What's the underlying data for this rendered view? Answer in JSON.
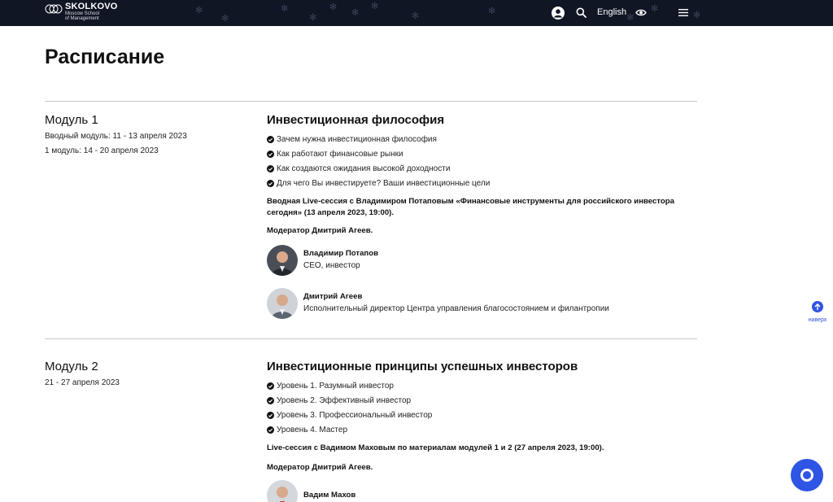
{
  "header": {
    "logo_name": "SKOLKOVO",
    "logo_sub1": "Moscow School",
    "logo_sub2": "of Management",
    "language": "English"
  },
  "page_title": "Расписание",
  "modules": [
    {
      "name": "Модуль 1",
      "dates": [
        "Вводный модуль: 11 - 13 апреля 2023",
        "1 модуль: 14 - 20 апреля 2023"
      ],
      "title": "Инвестиционная философия",
      "bullets": [
        "Зачем нужна инвестиционная философия",
        "Как работают финансовые рынки",
        "Как создаются ожидания высокой доходности",
        "Для чего Вы инвестируете? Ваши инвестиционные цели"
      ],
      "session": "Вводная Live-сессия с Владимиром Потаповым «Финансовые инструменты для российского инвестора сегодня» (13 апреля 2023, 19:00).",
      "moderator": "Модератор Дмитрий Агеев.",
      "speakers": [
        {
          "name": "Владимир Потапов",
          "role": "CEO, инвестор"
        },
        {
          "name": "Дмитрий Агеев",
          "role": "Исполнительный директор Центра управления благосостоянием и филантропии"
        }
      ]
    },
    {
      "name": "Модуль 2",
      "dates": [
        "21 - 27 апреля 2023"
      ],
      "title": "Инвестиционные принципы успешных инвесторов",
      "bullets": [
        "Уровень 1. Разумный инвестор",
        "Уровень 2. Эффективный инвестор",
        "Уровень 3. Профессиональный инвестор",
        "Уровень 4. Мастер"
      ],
      "session": "Live-сессия с Вадимом Маховым по материалам модулей 1 и 2 (27 апреля 2023, 19:00).",
      "moderator": "Модератор Дмитрий Агеев.",
      "speakers": [
        {
          "name": "Вадим Махов",
          "role": ""
        }
      ]
    }
  ],
  "to_top_label": "наверх",
  "icons": {
    "user": "user-icon",
    "search": "search-icon",
    "accessibility": "eye-icon",
    "menu": "menu-icon",
    "check": "check-circle-icon",
    "to_top": "arrow-up-circle-icon",
    "chat": "chat-icon"
  },
  "colors": {
    "header_bg": "#101624",
    "accent": "#2f55e4"
  }
}
